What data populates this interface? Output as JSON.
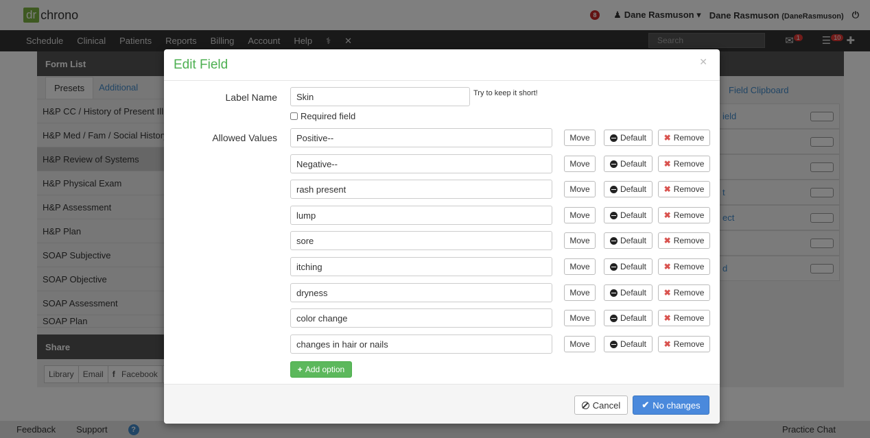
{
  "app": {
    "logo_prefix": "dr",
    "logo_name": "chrono",
    "notification_count": "8",
    "user_menu": "Dane Rasmuson",
    "account_name": "Dane Rasmuson",
    "account_username": "(DaneRasmuson)"
  },
  "nav": {
    "items": [
      "Schedule",
      "Clinical",
      "Patients",
      "Reports",
      "Billing",
      "Account",
      "Help"
    ],
    "search_placeholder": "Search",
    "messages_badge": "1",
    "tasks_badge": "10"
  },
  "form_list": {
    "title": "Form List",
    "tabs": [
      "Presets",
      "Additional"
    ],
    "items": [
      "H&P CC / History of Present Illness",
      "H&P Med / Fam / Social History",
      "H&P Review of Systems",
      "H&P Physical Exam",
      "H&P Assessment",
      "H&P Plan",
      "SOAP Subjective",
      "SOAP Objective",
      "SOAP Assessment",
      "SOAP Plan"
    ],
    "selected_index": 2
  },
  "share": {
    "title": "Share",
    "buttons": [
      "Library",
      "Email",
      "Facebook"
    ]
  },
  "right_panel": {
    "tab": "Field Clipboard",
    "items": [
      "ield",
      "",
      "",
      "t",
      "ect",
      "",
      "d"
    ]
  },
  "footer": {
    "feedback": "Feedback",
    "support": "Support",
    "practice_chat": "Practice Chat"
  },
  "modal": {
    "title": "Edit Field",
    "label_name_label": "Label Name",
    "label_name_value": "Skin",
    "hint": "Try to keep it short!",
    "required_label": "Required field",
    "allowed_values_label": "Allowed Values",
    "values": [
      "Positive--",
      "Negative--",
      "rash present",
      "lump",
      "sore",
      "itching",
      "dryness",
      "color change",
      "changes in hair or nails"
    ],
    "move_label": "Move",
    "default_label": "Default",
    "remove_label": "Remove",
    "add_option_label": "Add option",
    "cancel_label": "Cancel",
    "submit_label": "No changes"
  }
}
